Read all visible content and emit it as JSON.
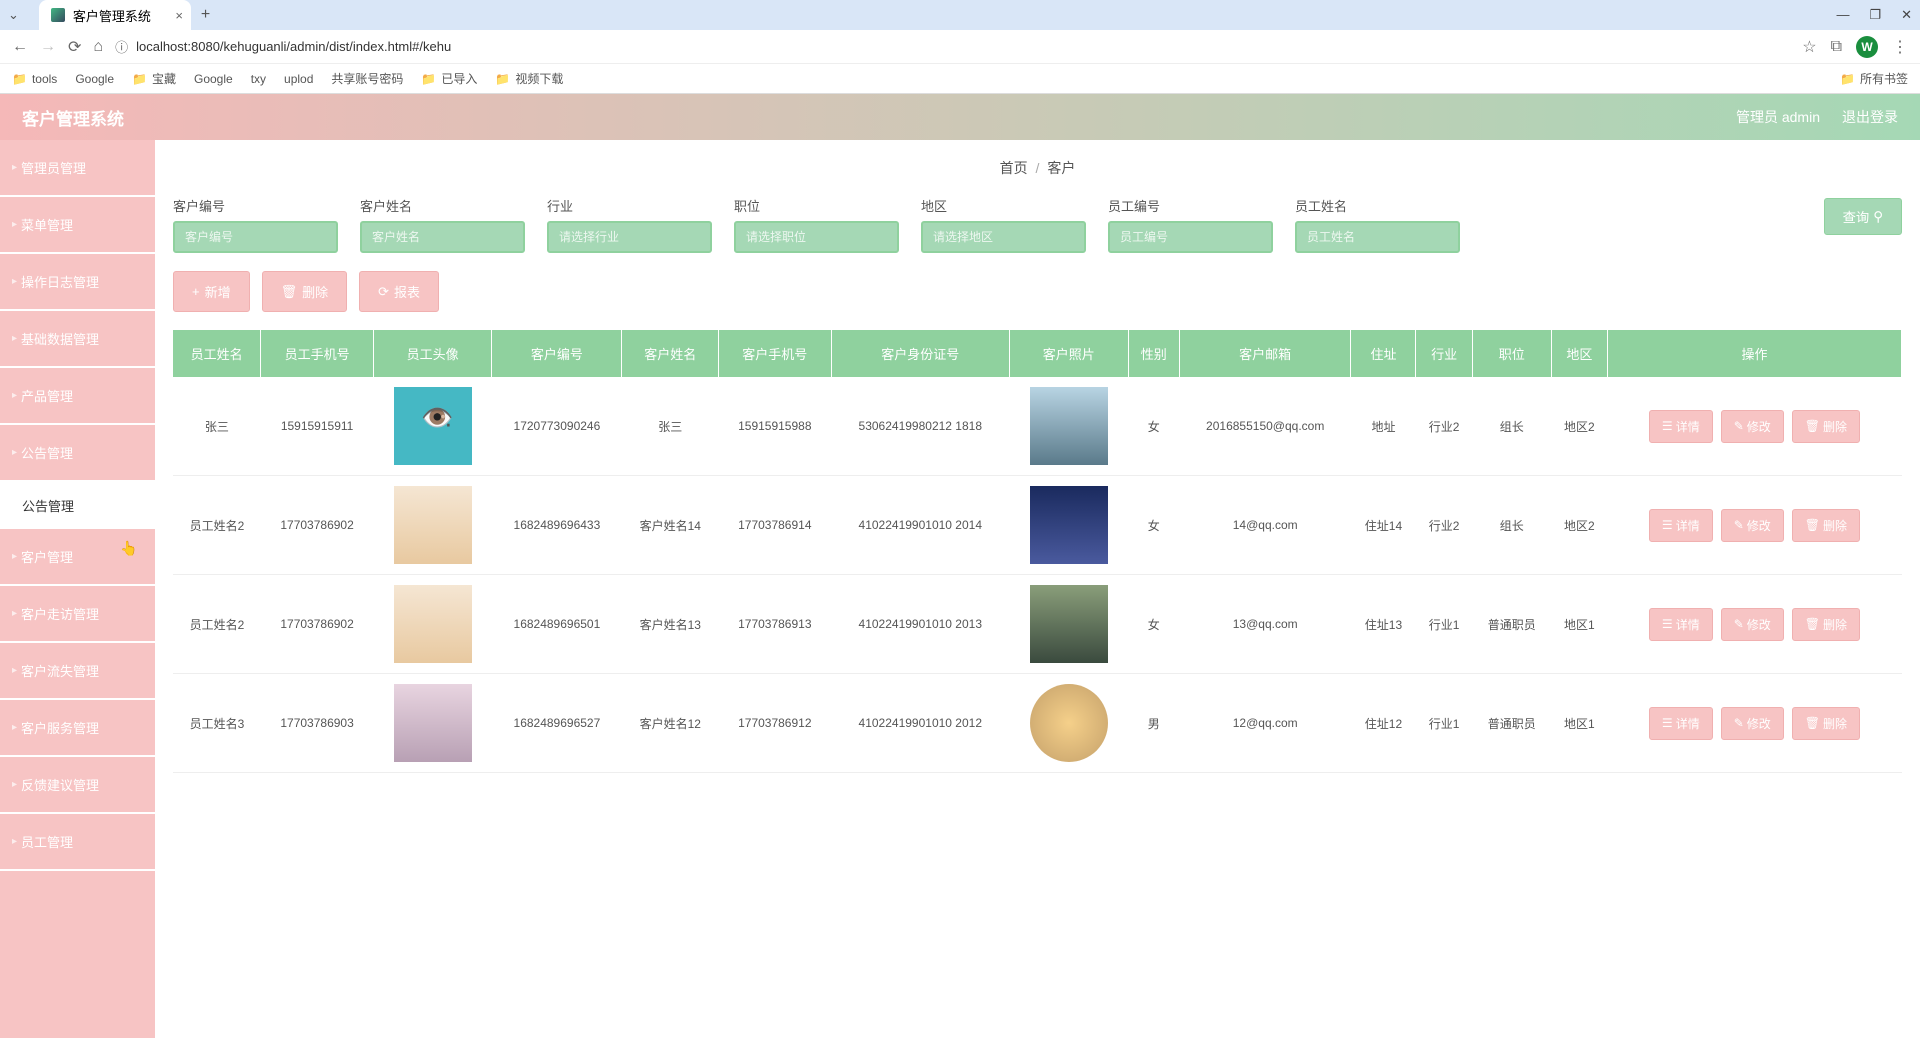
{
  "browser": {
    "tab_title": "客户管理系统",
    "url": "localhost:8080/kehuguanli/admin/dist/index.html#/kehu",
    "bookmarks": [
      "tools",
      "Google",
      "宝藏",
      "Google",
      "txy",
      "uplod",
      "共享账号密码",
      "已导入",
      "视频下载"
    ],
    "all_bookmarks": "所有书签",
    "avatar": "W"
  },
  "header": {
    "title": "客户管理系统",
    "admin": "管理员 admin",
    "logout": "退出登录"
  },
  "sidebar": {
    "items": [
      {
        "label": "管理员管理",
        "sub": false
      },
      {
        "label": "菜单管理",
        "sub": false
      },
      {
        "label": "操作日志管理",
        "sub": false
      },
      {
        "label": "基础数据管理",
        "sub": false
      },
      {
        "label": "产品管理",
        "sub": false
      },
      {
        "label": "公告管理",
        "sub": false
      },
      {
        "label": "公告管理",
        "sub": true
      },
      {
        "label": "客户管理",
        "sub": false
      },
      {
        "label": "客户走访管理",
        "sub": false
      },
      {
        "label": "客户流失管理",
        "sub": false
      },
      {
        "label": "客户服务管理",
        "sub": false
      },
      {
        "label": "反馈建议管理",
        "sub": false
      },
      {
        "label": "员工管理",
        "sub": false
      }
    ]
  },
  "breadcrumb": {
    "home": "首页",
    "current": "客户"
  },
  "filters": [
    {
      "label": "客户编号",
      "placeholder": "客户编号"
    },
    {
      "label": "客户姓名",
      "placeholder": "客户姓名"
    },
    {
      "label": "行业",
      "placeholder": "请选择行业"
    },
    {
      "label": "职位",
      "placeholder": "请选择职位"
    },
    {
      "label": "地区",
      "placeholder": "请选择地区"
    },
    {
      "label": "员工编号",
      "placeholder": "员工编号"
    },
    {
      "label": "员工姓名",
      "placeholder": "员工姓名"
    }
  ],
  "search_btn": "查询",
  "actions": {
    "add": "新增",
    "delete": "删除",
    "report": "报表"
  },
  "table": {
    "headers": [
      "员工姓名",
      "员工手机号",
      "员工头像",
      "客户编号",
      "客户姓名",
      "客户手机号",
      "客户身份证号",
      "客户照片",
      "性别",
      "客户邮箱",
      "住址",
      "行业",
      "职位",
      "地区",
      "操作"
    ],
    "rows": [
      {
        "emp_name": "张三",
        "emp_phone": "15915915911",
        "emp_avatar": "img1",
        "cust_no": "1720773090246",
        "cust_name": "张三",
        "cust_phone": "15915915988",
        "id_no": "53062419980212 1818",
        "photo": "img-castle",
        "gender": "女",
        "email": "2016855150@qq.com",
        "addr": "地址",
        "industry": "行业2",
        "pos": "组长",
        "region": "地区2"
      },
      {
        "emp_name": "员工姓名2",
        "emp_phone": "17703786902",
        "emp_avatar": "img-puppy",
        "cust_no": "1682489696433",
        "cust_name": "客户姓名14",
        "cust_phone": "17703786914",
        "id_no": "41022419901010 2014",
        "photo": "img-eiffel",
        "gender": "女",
        "email": "14@qq.com",
        "addr": "住址14",
        "industry": "行业2",
        "pos": "组长",
        "region": "地区2"
      },
      {
        "emp_name": "员工姓名2",
        "emp_phone": "17703786902",
        "emp_avatar": "img-puppy",
        "cust_no": "1682489696501",
        "cust_name": "客户姓名13",
        "cust_phone": "17703786913",
        "id_no": "41022419901010 2013",
        "photo": "img-mountain",
        "gender": "女",
        "email": "13@qq.com",
        "addr": "住址13",
        "industry": "行业1",
        "pos": "普通职员",
        "region": "地区1"
      },
      {
        "emp_name": "员工姓名3",
        "emp_phone": "17703786903",
        "emp_avatar": "img-anime",
        "cust_no": "1682489696527",
        "cust_name": "客户姓名12",
        "cust_phone": "17703786912",
        "id_no": "41022419901010 2012",
        "photo": "img-sunset",
        "gender": "男",
        "email": "12@qq.com",
        "addr": "住址12",
        "industry": "行业1",
        "pos": "普通职员",
        "region": "地区1"
      }
    ],
    "row_actions": {
      "detail": "详情",
      "edit": "修改",
      "delete": "删除"
    }
  }
}
